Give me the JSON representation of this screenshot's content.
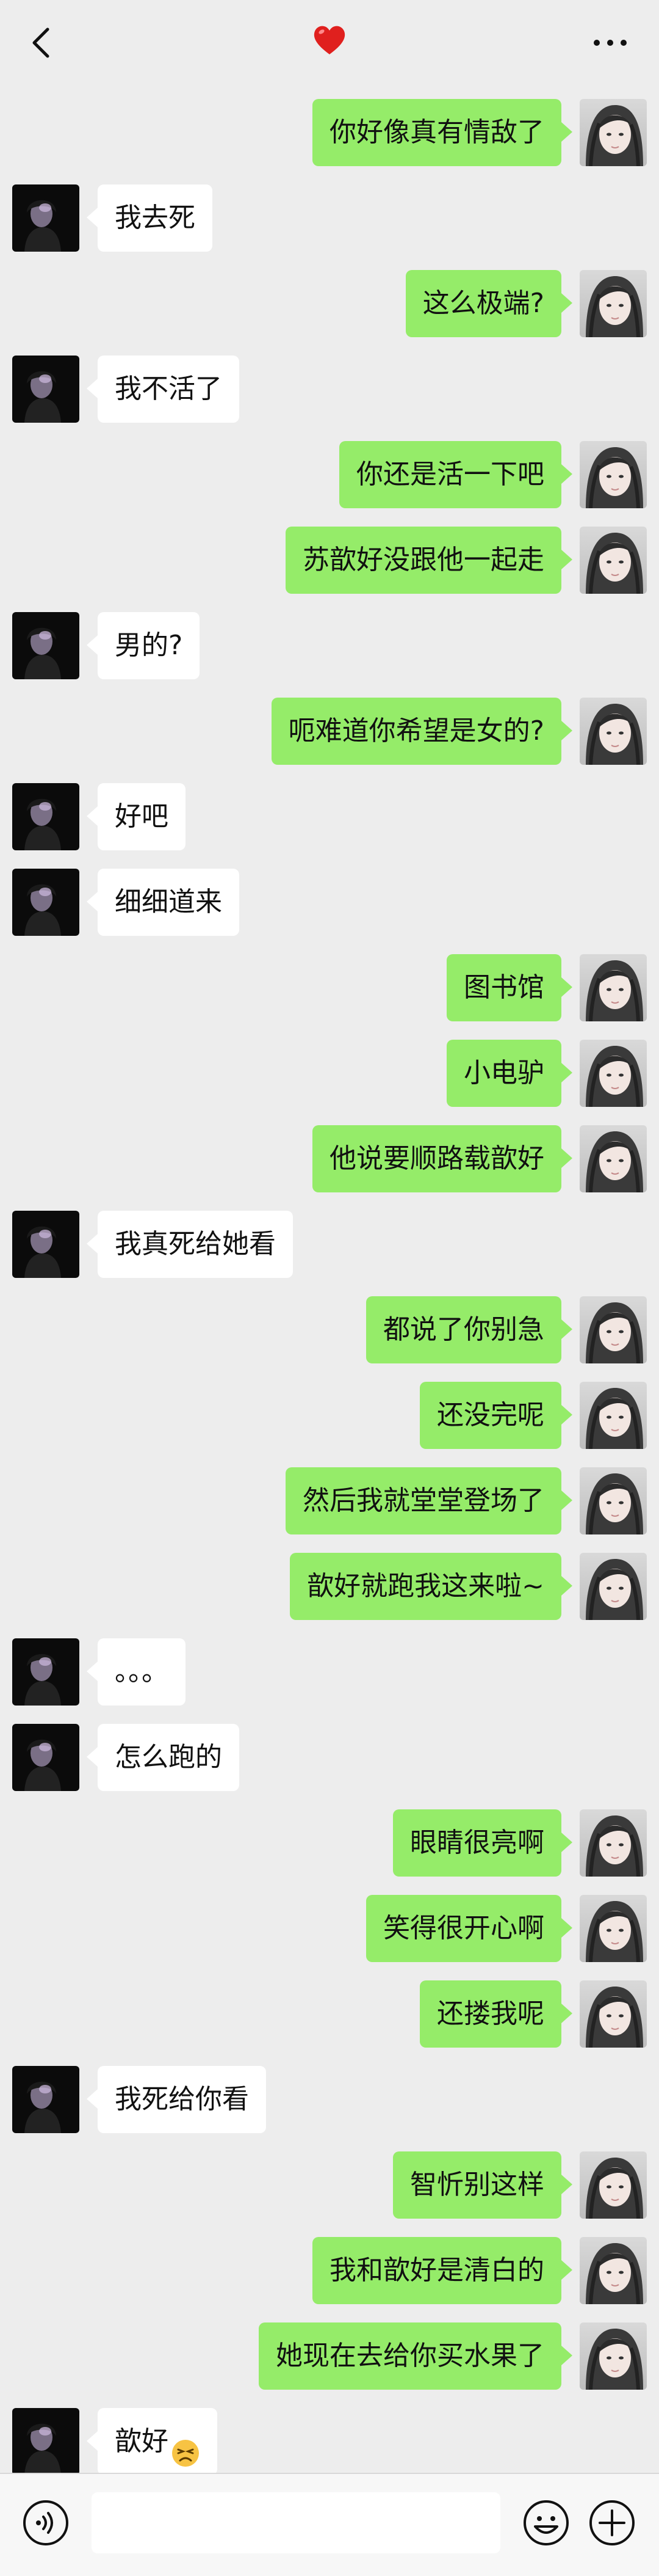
{
  "header": {
    "back_icon": "chevron-left-icon",
    "title_icon": "red-heart-icon",
    "more_icon": "more-horizontal-icon",
    "heart_color": "#e0201e"
  },
  "colors": {
    "background": "#ededed",
    "sent_bubble": "#95ec69",
    "received_bubble": "#ffffff"
  },
  "messages": [
    {
      "side": "right",
      "text": "你好像真有情敌了"
    },
    {
      "side": "left",
      "text": "我去死"
    },
    {
      "side": "right",
      "text": "这么极端?"
    },
    {
      "side": "left",
      "text": "我不活了"
    },
    {
      "side": "right",
      "text": "你还是活一下吧"
    },
    {
      "side": "right",
      "text": "苏歆好没跟他一起走"
    },
    {
      "side": "left",
      "text": "男的?"
    },
    {
      "side": "right",
      "text": "呃难道你希望是女的?"
    },
    {
      "side": "left",
      "text": "好吧"
    },
    {
      "side": "left",
      "text": "细细道来"
    },
    {
      "side": "right",
      "text": "图书馆"
    },
    {
      "side": "right",
      "text": "小电驴"
    },
    {
      "side": "right",
      "text": "他说要顺路载歆好"
    },
    {
      "side": "left",
      "text": "我真死给她看"
    },
    {
      "side": "right",
      "text": "都说了你别急"
    },
    {
      "side": "right",
      "text": "还没完呢"
    },
    {
      "side": "right",
      "text": "然后我就堂堂登场了"
    },
    {
      "side": "right",
      "text": "歆好就跑我这来啦~"
    },
    {
      "side": "left",
      "text": "。。。"
    },
    {
      "side": "left",
      "text": "怎么跑的"
    },
    {
      "side": "right",
      "text": "眼睛很亮啊"
    },
    {
      "side": "right",
      "text": "笑得很开心啊"
    },
    {
      "side": "right",
      "text": "还搂我呢"
    },
    {
      "side": "left",
      "text": "我死给你看"
    },
    {
      "side": "right",
      "text": "智忻别这样"
    },
    {
      "side": "right",
      "text": "我和歆好是清白的"
    },
    {
      "side": "right",
      "text": "她现在去给你买水果了"
    },
    {
      "side": "left",
      "text": "歆好",
      "emoji": "persevering-face-emoji"
    }
  ],
  "input_bar": {
    "voice_icon": "voice-icon",
    "placeholder": "",
    "emoji_icon": "smiley-icon",
    "plus_icon": "plus-circle-icon"
  }
}
